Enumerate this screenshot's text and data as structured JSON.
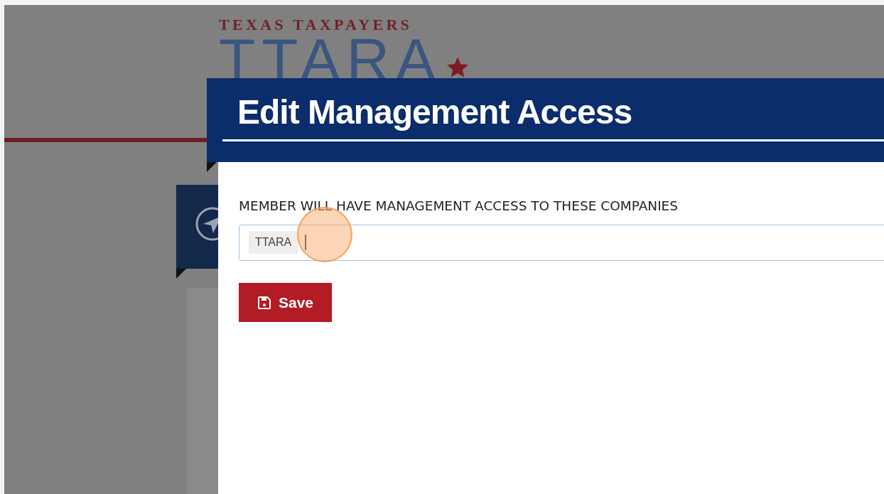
{
  "background": {
    "logo": {
      "tagline": "TEXAS TAXPAYERS",
      "wordmark": "TTARA"
    }
  },
  "modal": {
    "title": "Edit Management Access",
    "field_label": "MEMBER WILL HAVE MANAGEMENT ACCESS TO THESE COMPANIES",
    "tags": [
      "TTARA"
    ],
    "save_button": "Save"
  }
}
